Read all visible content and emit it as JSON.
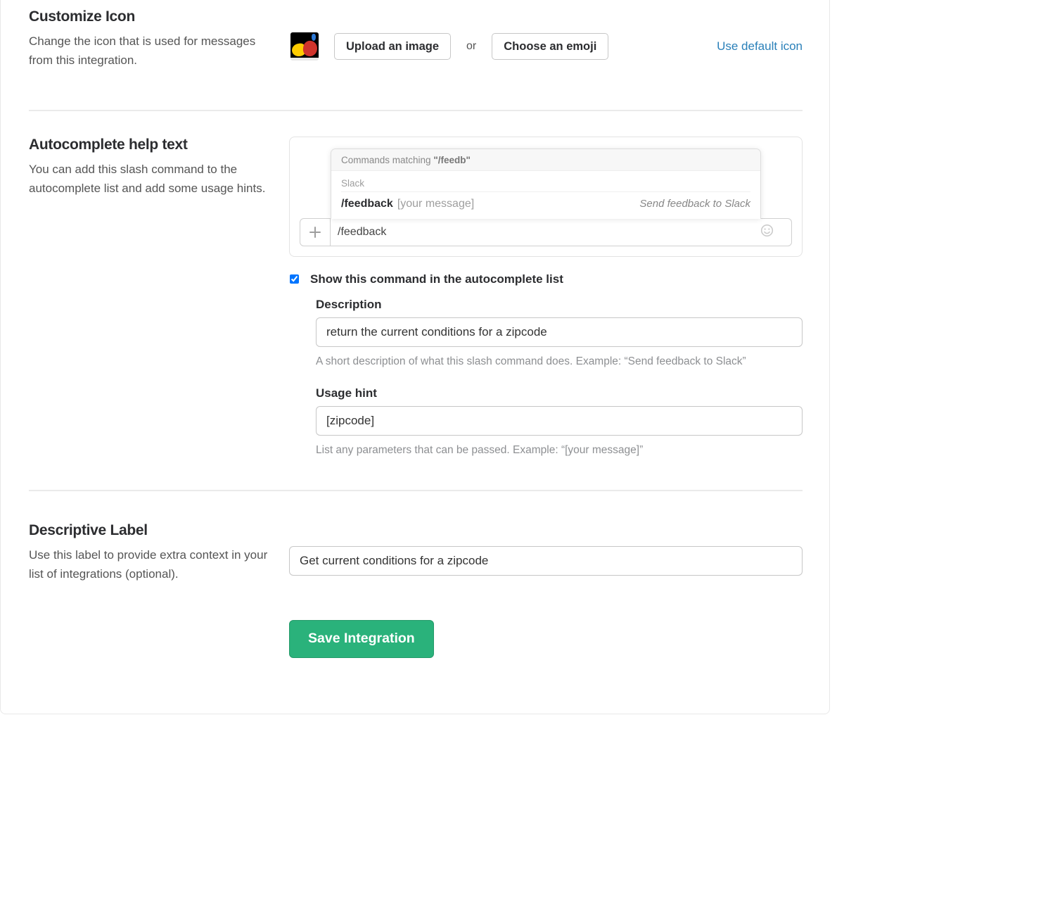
{
  "customize_icon": {
    "title": "Customize Icon",
    "desc": "Change the icon that is used for messages from this integration.",
    "upload_label": "Upload an image",
    "or_text": "or",
    "emoji_label": "Choose an emoji",
    "default_link": "Use default icon"
  },
  "autocomplete": {
    "title": "Autocomplete help text",
    "desc": "You can add this slash command to the autocomplete list and add some usage hints.",
    "preview": {
      "matching_prefix": "Commands matching ",
      "matching_typed": "\"/feedb\"",
      "group_label": "Slack",
      "cmd": "/feedback",
      "cmd_hint": "[your message]",
      "cmd_desc": "Send feedback to Slack",
      "input_value": "/feedback"
    },
    "checkbox_label": "Show this command in the autocomplete list",
    "checkbox_checked": true,
    "description": {
      "label": "Description",
      "value": "return the current conditions for a zipcode",
      "help": "A short description of what this slash command does. Example: “Send feedback to Slack”"
    },
    "usage": {
      "label": "Usage hint",
      "value": "[zipcode]",
      "help": "List any parameters that can be passed. Example: “[your message]”"
    }
  },
  "descriptive_label": {
    "title": "Descriptive Label",
    "desc": "Use this label to provide extra context in your list of integrations (optional).",
    "value": "Get current conditions for a zipcode"
  },
  "save_button": "Save Integration"
}
